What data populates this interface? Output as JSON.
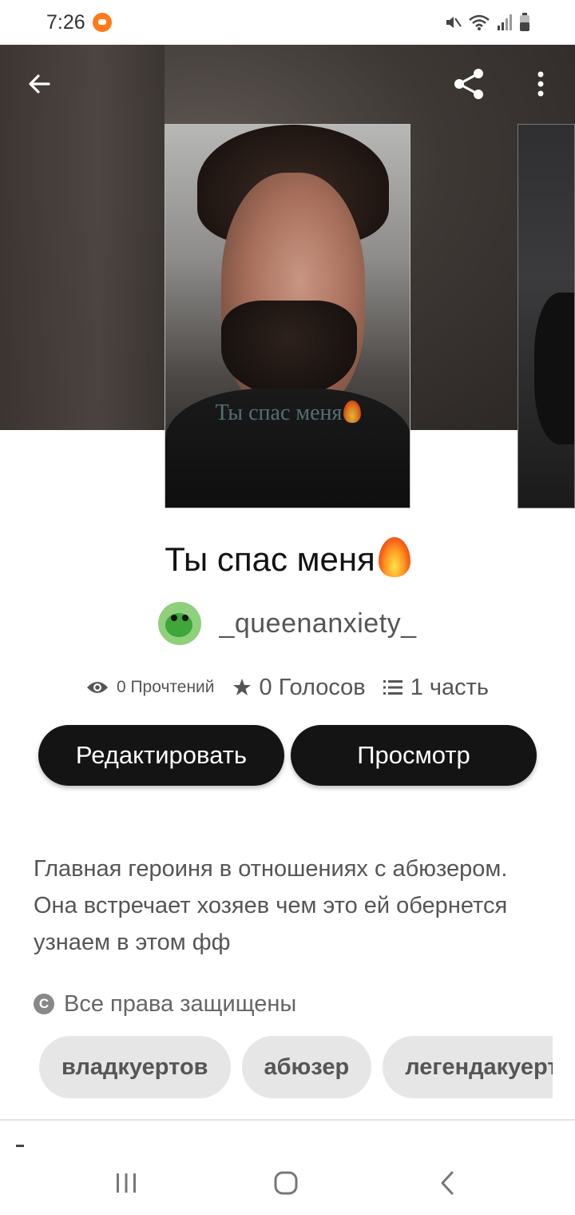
{
  "status_bar": {
    "time": "7:26",
    "icons": [
      "mute-icon",
      "wifi-icon",
      "signal-icon",
      "battery-icon"
    ]
  },
  "top_bar": {
    "back_icon": "arrow-left-icon",
    "share_icon": "share-icon",
    "more_icon": "more-vertical-icon"
  },
  "cover": {
    "caption": "Ты спас меня"
  },
  "story": {
    "title": "Ты спас меня",
    "author": "_queenanxiety_",
    "reads": "0 Прочтений",
    "votes": "0 Голосов",
    "parts": "1 часть",
    "description": "Главная героиня в отношениях с абюзером. Она встречает хозяев чем это ей обернется узнаем в этом фф",
    "rights": "Все права защищены"
  },
  "actions": {
    "edit_label": "Редактировать",
    "view_label": "Просмотр"
  },
  "tags": [
    "владкуертов",
    "абюзер",
    "легендакуертов"
  ],
  "colors": {
    "button_bg": "#141414",
    "tag_bg": "#e6e6e7",
    "flame": "#f04a14"
  },
  "system_nav": [
    "recent-apps-icon",
    "home-icon",
    "back-icon"
  ]
}
